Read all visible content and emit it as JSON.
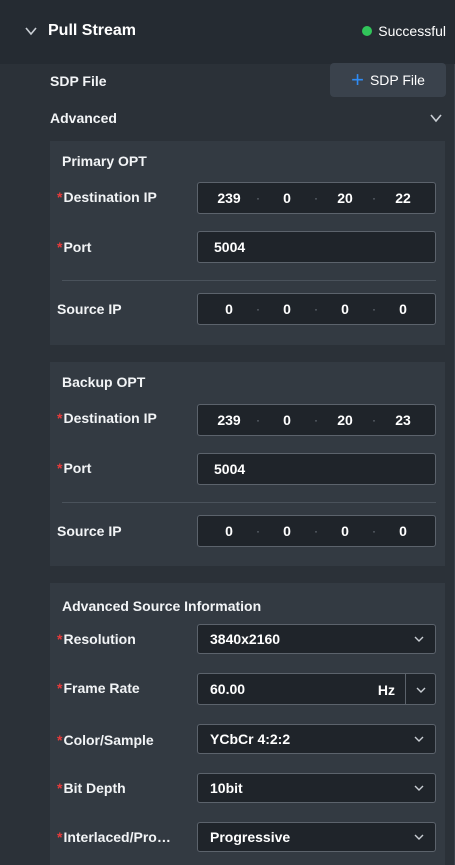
{
  "header": {
    "title": "Pull Stream",
    "status": "Successful",
    "status_color": "#31c55a"
  },
  "sdp": {
    "label": "SDP File",
    "button_label": "SDP File"
  },
  "advanced": {
    "label": "Advanced"
  },
  "primary": {
    "title": "Primary OPT",
    "destination_ip_label": "Destination IP",
    "destination_ip": [
      "239",
      "0",
      "20",
      "22"
    ],
    "port_label": "Port",
    "port": "5004",
    "source_ip_label": "Source IP",
    "source_ip": [
      "0",
      "0",
      "0",
      "0"
    ]
  },
  "backup": {
    "title": "Backup OPT",
    "destination_ip_label": "Destination IP",
    "destination_ip": [
      "239",
      "0",
      "20",
      "23"
    ],
    "port_label": "Port",
    "port": "5004",
    "source_ip_label": "Source IP",
    "source_ip": [
      "0",
      "0",
      "0",
      "0"
    ]
  },
  "source_info": {
    "title": "Advanced Source Information",
    "resolution_label": "Resolution",
    "resolution": "3840x2160",
    "frame_rate_label": "Frame Rate",
    "frame_rate": "60.00",
    "frame_rate_unit": "Hz",
    "color_sample_label": "Color/Sample",
    "color_sample": "YCbCr 4:2:2",
    "bit_depth_label": "Bit Depth",
    "bit_depth": "10bit",
    "scan_label": "Interlaced/Pro…",
    "scan": "Progressive"
  },
  "required_marker": "*",
  "ip_separator": "·",
  "accent_color": "#2f8cf5"
}
